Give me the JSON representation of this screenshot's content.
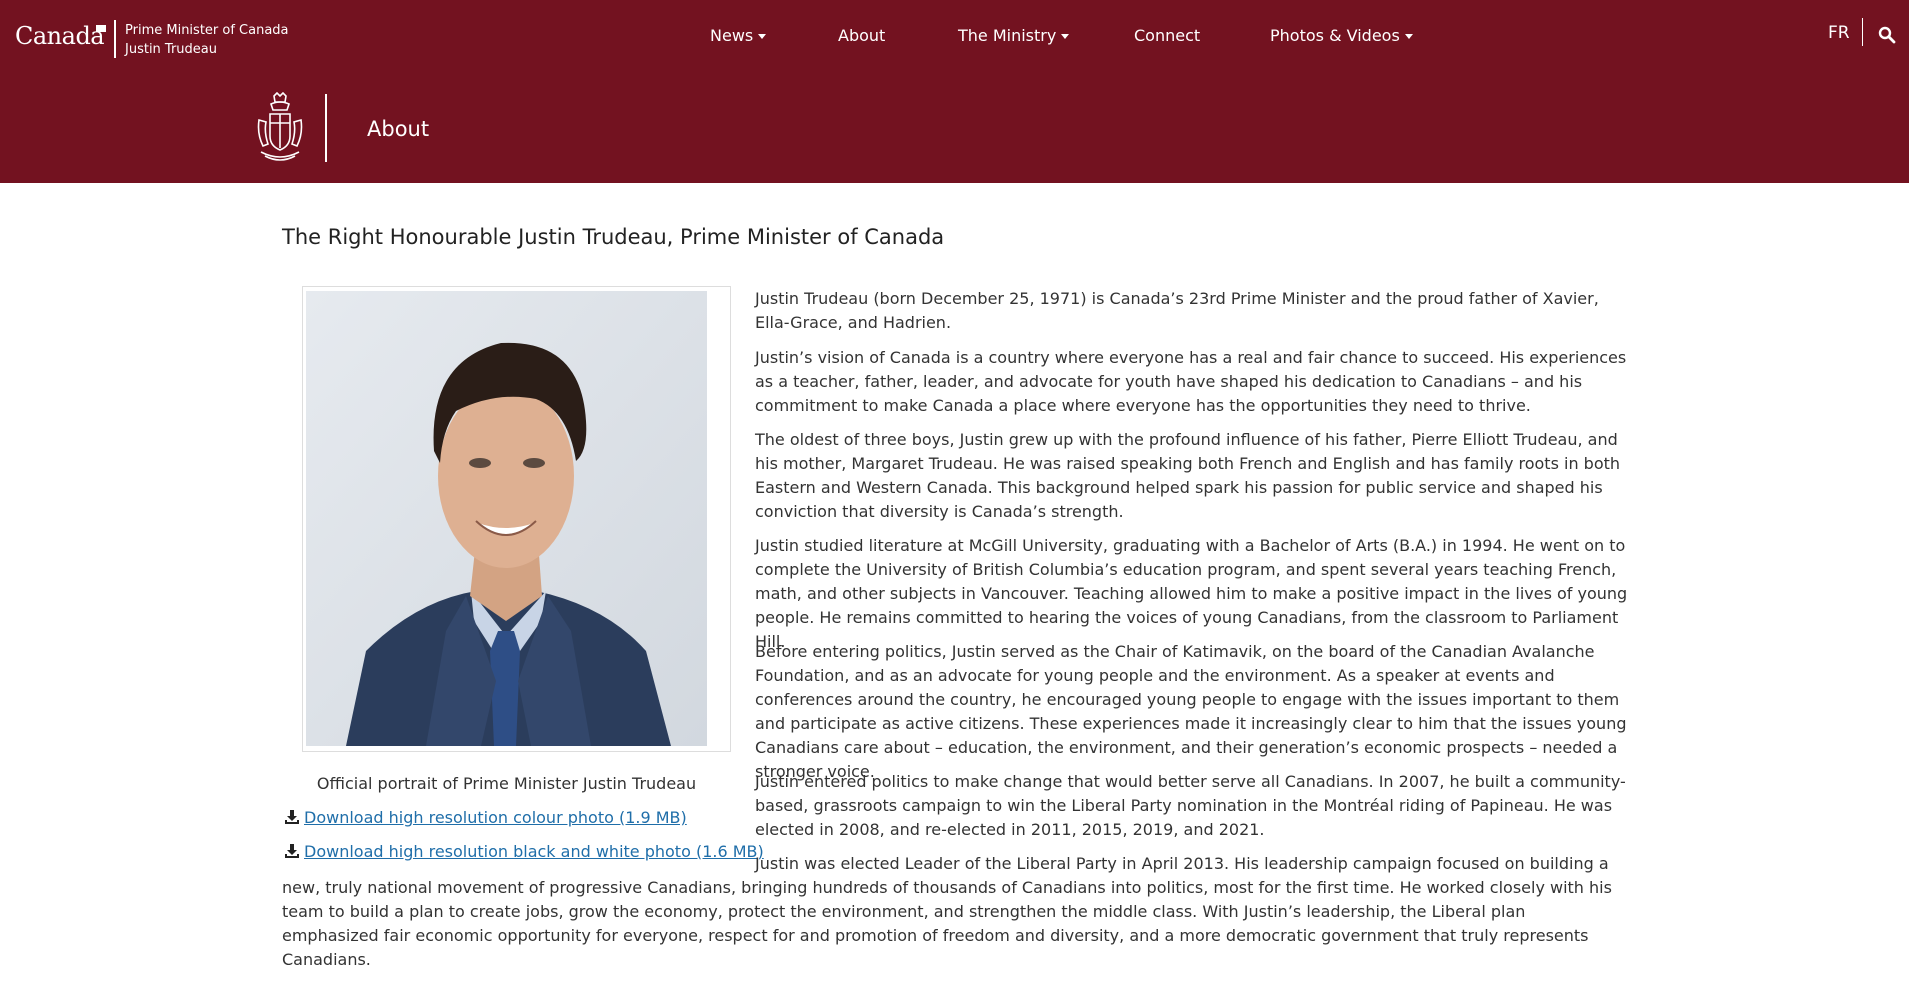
{
  "header": {
    "wordmark": "Canada",
    "pm_title_line1": "Prime Minister of Canada",
    "pm_title_line2": "Justin Trudeau",
    "nav": [
      {
        "label": "News",
        "has_dropdown": true
      },
      {
        "label": "About",
        "has_dropdown": false
      },
      {
        "label": "The Ministry",
        "has_dropdown": true
      },
      {
        "label": "Connect",
        "has_dropdown": false
      },
      {
        "label": "Photos & Videos",
        "has_dropdown": true
      }
    ],
    "language_toggle": "FR",
    "section_title": "About",
    "colors": {
      "brand": "#731220",
      "link": "#1f6ea9"
    },
    "icons": {
      "search": "search-icon",
      "crest": "coat-of-arms-icon"
    }
  },
  "main": {
    "heading": "The Right Honourable Justin Trudeau, Prime Minister of Canada",
    "portrait_caption": "Official portrait of Prime Minister Justin Trudeau",
    "downloads": [
      {
        "label": "Download high resolution colour photo (1.9 MB)",
        "icon": "download-icon"
      },
      {
        "label": "Download high resolution black and white photo (1.6 MB)",
        "icon": "download-icon"
      }
    ],
    "paragraphs": [
      "Justin Trudeau (born December 25, 1971) is Canada’s 23rd Prime Minister and the proud father of Xavier, Ella-Grace, and Hadrien.",
      "Justin’s vision of Canada is a country where everyone has a real and fair chance to succeed. His experiences as a teacher, father, leader, and advocate for youth have shaped his dedication to Canadians – and his commitment to make Canada a place where everyone has the opportunities they need to thrive.",
      "The oldest of three boys, Justin grew up with the profound influence of his father, Pierre Elliott Trudeau, and his mother, Margaret Trudeau. He was raised speaking both French and English and has family roots in both Eastern and Western Canada. This background helped spark his passion for public service and shaped his conviction that diversity is Canada’s strength.",
      "Justin studied literature at McGill University, graduating with a Bachelor of Arts (B.A.) in 1994. He went on to complete the University of British Columbia’s education program, and spent several years teaching French, math, and other subjects in Vancouver. Teaching allowed him to make a positive impact in the lives of young people. He remains committed to hearing the voices of young Canadians, from the classroom to Parliament Hill.",
      "Before entering politics, Justin served as the Chair of Katimavik, on the board of the Canadian Avalanche Foundation, and as an advocate for young people and the environment. As a speaker at events and conferences around the country, he encouraged young people to engage with the issues important to them and participate as active citizens. These experiences made it increasingly clear to him that the issues young Canadians care about – education, the environment, and their generation’s economic prospects – needed a stronger voice.",
      "Justin entered politics to make change that would better serve all Canadians. In 2007, he built a community-based, grassroots campaign to win the Liberal Party nomination in the Montréal riding of Papineau. He was elected in 2008, and re-elected in 2011, 2015, 2019, and 2021.",
      "Justin was elected Leader of the Liberal Party in April 2013. His leadership campaign focused on building a new, truly national movement of progressive Canadians, bringing hundreds of thousands of Canadians into politics, most for the first time. He worked closely with his team to build a plan to create jobs, grow the economy, protect the environment, and strengthen the middle class. With Justin’s leadership, the Liberal plan emphasized fair economic opportunity for everyone, respect for and promotion of freedom and diversity, and a more democratic government that truly represents Canadians."
    ]
  }
}
